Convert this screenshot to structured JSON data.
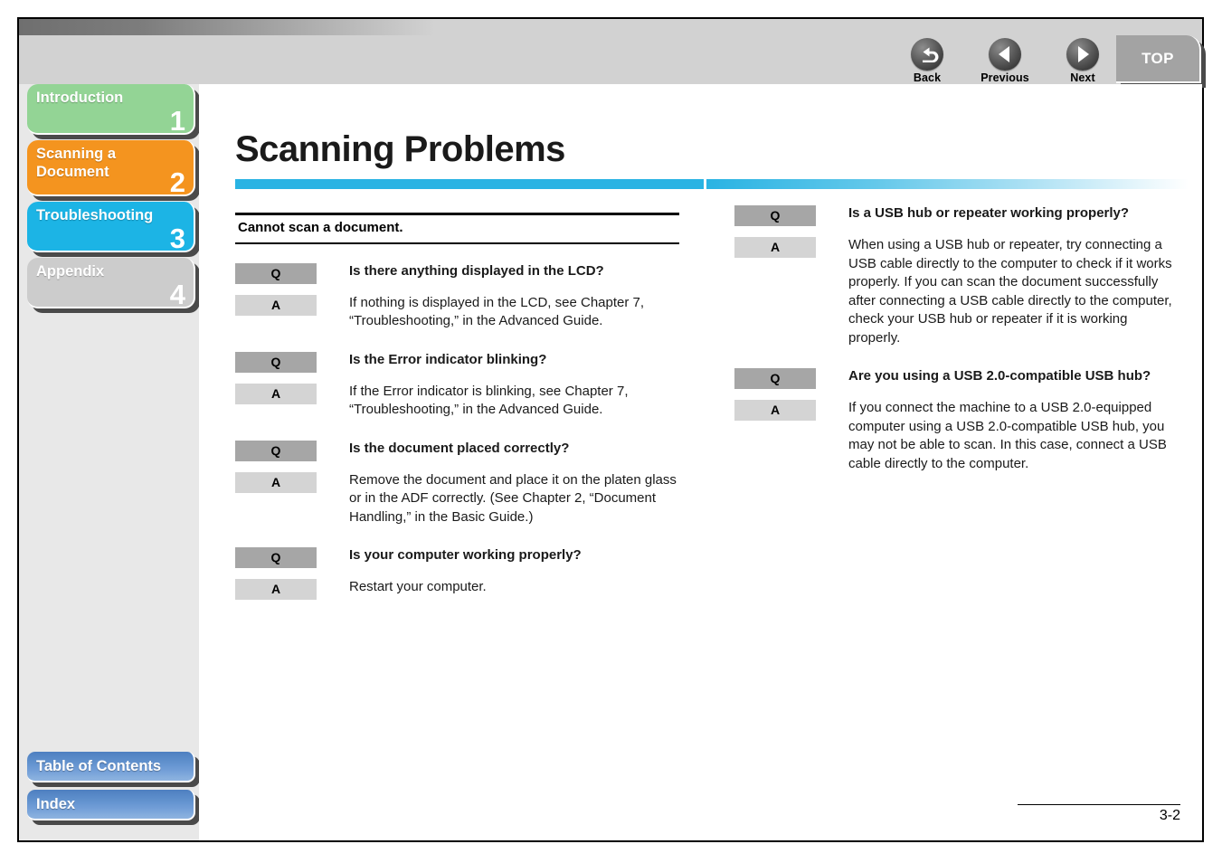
{
  "header": {
    "nav_buttons": [
      {
        "label": "Back",
        "icon": "back-arrow-icon"
      },
      {
        "label": "Previous",
        "icon": "previous-triangle-icon"
      },
      {
        "label": "Next",
        "icon": "next-triangle-icon"
      }
    ],
    "top_button_label": "TOP"
  },
  "sidebar": {
    "chapters": [
      {
        "label": "Introduction",
        "number": "1",
        "color": "#93d495",
        "active": false
      },
      {
        "label": "Scanning a Document",
        "number": "2",
        "color": "#f4941f",
        "active": false
      },
      {
        "label": "Troubleshooting",
        "number": "3",
        "color": "#1cb4e5",
        "active": true
      },
      {
        "label": "Appendix",
        "number": "4",
        "color": "#cccccc",
        "active": false
      }
    ],
    "bottom_buttons": [
      {
        "label": "Table of Contents"
      },
      {
        "label": "Index"
      }
    ]
  },
  "main": {
    "title": "Scanning Problems",
    "section_heading": "Cannot scan a document.",
    "left_column": [
      {
        "q_badge": "Q",
        "a_badge": "A",
        "question": "Is there anything displayed in the LCD?",
        "answer": "If nothing is displayed in the LCD, see Chapter 7, “Troubleshooting,” in the Advanced Guide."
      },
      {
        "q_badge": "Q",
        "a_badge": "A",
        "question": "Is the Error indicator blinking?",
        "answer": "If the Error indicator is blinking, see Chapter 7, “Troubleshooting,” in the Advanced Guide."
      },
      {
        "q_badge": "Q",
        "a_badge": "A",
        "question": "Is the document placed correctly?",
        "answer": "Remove the document and place it on the platen glass or in the ADF correctly. (See Chapter 2, “Document Handling,” in the Basic Guide.)"
      },
      {
        "q_badge": "Q",
        "a_badge": "A",
        "question": "Is your computer working properly?",
        "answer": "Restart your computer."
      }
    ],
    "right_column": [
      {
        "q_badge": "Q",
        "a_badge": "A",
        "question": "Is a USB hub or repeater working properly?",
        "answer": "When using a USB hub or repeater, try connecting a USB cable directly to the computer to check if it works properly. If you can scan the document successfully after connecting a USB cable directly to the computer, check your USB hub or repeater if it is working properly."
      },
      {
        "q_badge": "Q",
        "a_badge": "A",
        "question": "Are you using a USB 2.0-compatible USB hub?",
        "answer": "If you connect the machine to a USB 2.0-equipped computer using a USB 2.0-compatible USB hub, you may not be able to scan. In this case, connect a USB cable directly to the computer."
      }
    ]
  },
  "footer": {
    "page_number": "3-2"
  },
  "colors": {
    "accent_cyan": "#29b3e3",
    "chapter_green": "#93d495",
    "chapter_orange": "#f4941f",
    "chapter_blue": "#1cb4e5",
    "chapter_gray": "#cccccc",
    "badge_q": "#a6a6a6",
    "badge_a": "#d4d4d4",
    "sidebar_bg": "#e8e8e8",
    "header_bg": "#d2d2d2"
  }
}
